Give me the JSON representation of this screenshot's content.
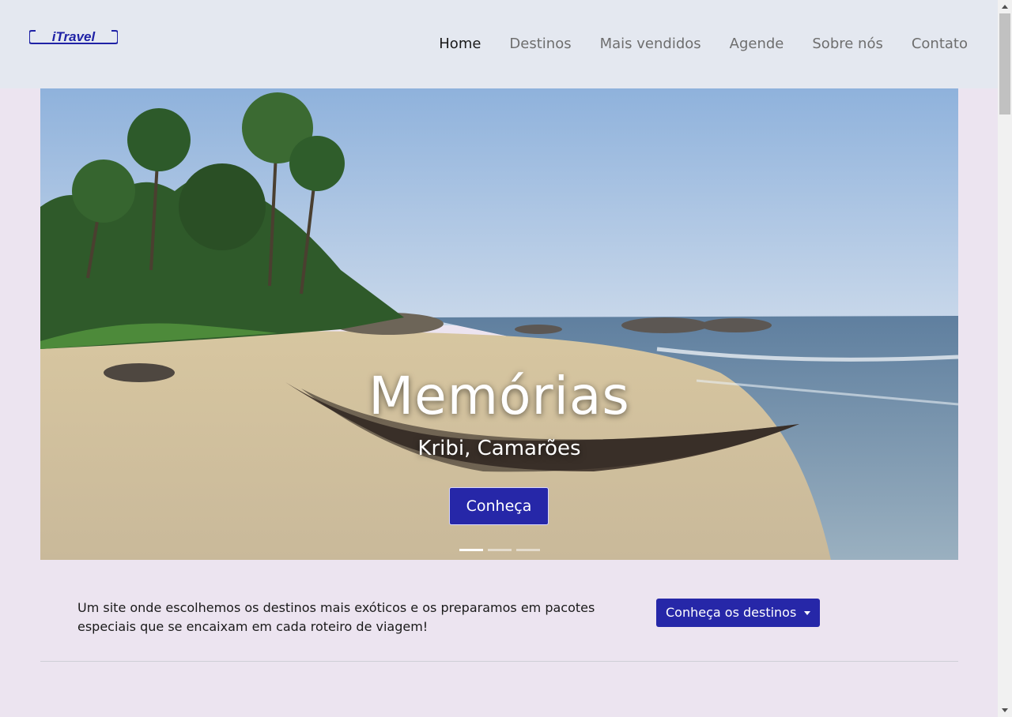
{
  "navbar": {
    "logo_text": "iTravel",
    "items": [
      {
        "label": "Home",
        "active": true
      },
      {
        "label": "Destinos",
        "active": false
      },
      {
        "label": "Mais vendidos",
        "active": false
      },
      {
        "label": "Agende",
        "active": false
      },
      {
        "label": "Sobre nós",
        "active": false
      },
      {
        "label": "Contato",
        "active": false
      }
    ]
  },
  "hero": {
    "title": "Memórias",
    "subtitle": "Kribi, Camarões",
    "button_label": "Conheça",
    "slide_count": 3,
    "active_slide": 1
  },
  "intro": {
    "text": "Um site onde escolhemos os destinos mais exóticos e os preparamos em pacotes especiais que se encaixam em cada roteiro de viagem!",
    "dropdown_label": "Conheça os destinos"
  },
  "colors": {
    "brand": "#2627a8",
    "navbar_bg": "#e4e8f0",
    "page_bg": "#ece4f0"
  }
}
